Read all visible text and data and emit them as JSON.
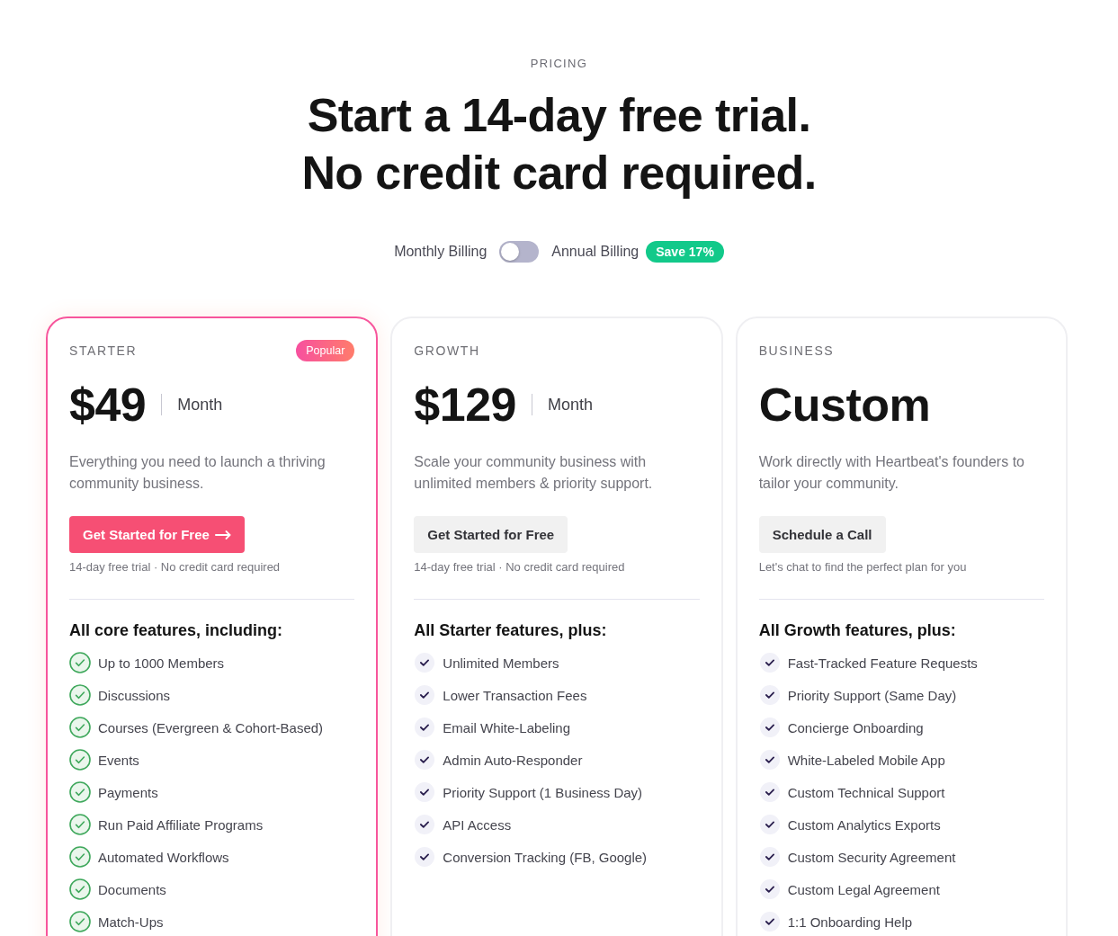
{
  "header": {
    "eyebrow": "PRICING",
    "title_lines": [
      "Start a 14-day free trial.",
      "No credit card required."
    ]
  },
  "billing": {
    "monthly_label": "Monthly Billing",
    "toggle": {
      "on": false
    },
    "annual_label": "Annual Billing",
    "badge": "Save 17%"
  },
  "plans": [
    {
      "name": "STARTER",
      "highlighted": true,
      "badge": "Popular",
      "price": "$49",
      "period": "Month",
      "description": "Everything you need to launch a thriving community business.",
      "button": {
        "label": "Get Started for Free",
        "kind": "primary",
        "arrow": true
      },
      "note": "14-day free trial · No credit card required",
      "features_title": "All core features, including:",
      "features": [
        "Up to 1000 Members",
        "Discussions",
        "Courses (Evergreen & Cohort-Based)",
        "Events",
        "Payments",
        "Run Paid Affiliate Programs",
        "Automated Workflows",
        "Documents",
        "Match-Ups"
      ]
    },
    {
      "name": "GROWTH",
      "highlighted": false,
      "price": "$129",
      "period": "Month",
      "description": "Scale your community business with unlimited members & priority support.",
      "button": {
        "label": "Get Started for Free",
        "kind": "secondary",
        "arrow": false
      },
      "note": "14-day free trial · No credit card required",
      "features_title": "All Starter features, plus:",
      "features": [
        "Unlimited Members",
        "Lower Transaction Fees",
        "Email White-Labeling",
        "Admin Auto-Responder",
        "Priority Support (1 Business Day)",
        "API Access",
        "Conversion Tracking (FB, Google)"
      ]
    },
    {
      "name": "BUSINESS",
      "highlighted": false,
      "price": "Custom",
      "description": "Work directly with Heartbeat's founders to tailor your community.",
      "button": {
        "label": "Schedule a Call",
        "kind": "secondary",
        "arrow": false
      },
      "note": "Let's chat to find the perfect plan for you",
      "features_title": "All Growth features, plus:",
      "features": [
        "Fast-Tracked Feature Requests",
        "Priority Support (Same Day)",
        "Concierge Onboarding",
        "White-Labeled Mobile App",
        "Custom Technical Support",
        "Custom Analytics Exports",
        "Custom Security Agreement",
        "Custom Legal Agreement",
        "1:1 Onboarding Help"
      ]
    }
  ]
}
